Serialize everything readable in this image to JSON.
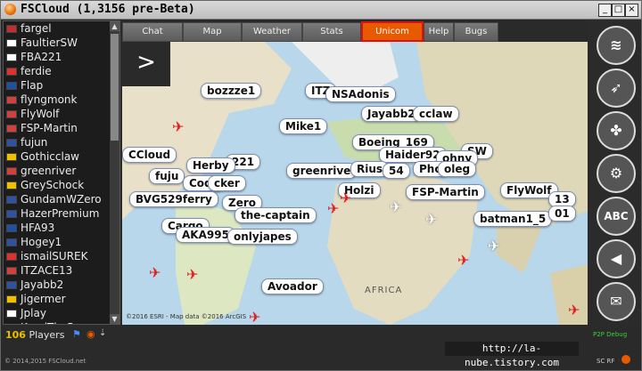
{
  "window": {
    "title": "FSCloud (1,3156 pre-Beta)",
    "buttons": [
      "_",
      "□",
      "×"
    ]
  },
  "sidebar": {
    "users": [
      {
        "name": "fargel",
        "flag": "#c03030"
      },
      {
        "name": "FaultierSW",
        "flag": "#ffffff"
      },
      {
        "name": "FBA221",
        "flag": "#ffffff"
      },
      {
        "name": "ferdie",
        "flag": "#e03030"
      },
      {
        "name": "Flap",
        "flag": "#2050a0"
      },
      {
        "name": "flyngmonk",
        "flag": "#d04040"
      },
      {
        "name": "FlyWolf",
        "flag": "#d04040"
      },
      {
        "name": "FSP-Martin",
        "flag": "#d04040"
      },
      {
        "name": "fujun",
        "flag": "#3050a0"
      },
      {
        "name": "Gothicclaw",
        "flag": "#f0c000"
      },
      {
        "name": "greenriver",
        "flag": "#d04040"
      },
      {
        "name": "GreySchock",
        "flag": "#f0c000"
      },
      {
        "name": "GundamWZero",
        "flag": "#3050a0"
      },
      {
        "name": "HazerPremium",
        "flag": "#3050a0"
      },
      {
        "name": "HFA93",
        "flag": "#2050a0"
      },
      {
        "name": "Hogey1",
        "flag": "#3050a0"
      },
      {
        "name": "ismailSUREK",
        "flag": "#e03030"
      },
      {
        "name": "ITZACE13",
        "flag": "#d04040"
      },
      {
        "name": "Jayabb2",
        "flag": "#3050a0"
      },
      {
        "name": "Jigermer",
        "flag": "#f0c000"
      },
      {
        "name": "Jplay",
        "flag": "#ffffff"
      },
      {
        "name": "KamiThePony",
        "flag": "#202020"
      }
    ],
    "players_count": "106",
    "players_label": "Players"
  },
  "tabs": [
    {
      "label": "Chat",
      "active": false
    },
    {
      "label": "Map",
      "active": false
    },
    {
      "label": "Weather",
      "active": false
    },
    {
      "label": "Stats",
      "active": false
    },
    {
      "label": "Unicom",
      "active": true
    },
    {
      "label": "Help",
      "active": false
    },
    {
      "label": "Bugs",
      "active": false
    }
  ],
  "map": {
    "toggle_symbol": ">",
    "region_label": "AFRICA",
    "attribution": "©2016 ESRI - Map data ©2016 ArcGIS",
    "callsigns": [
      {
        "name": "bozzze1"
      },
      {
        "name": "ITZ"
      },
      {
        "name": "NSAdonis"
      },
      {
        "name": "Jayabb2"
      },
      {
        "name": "cclaw"
      },
      {
        "name": "Mike1"
      },
      {
        "name": "Boeing_169"
      },
      {
        "name": "SW"
      },
      {
        "name": "Haider92"
      },
      {
        "name": "ohny"
      },
      {
        "name": "CCloud"
      },
      {
        "name": "221"
      },
      {
        "name": "Herby"
      },
      {
        "name": "greenrive"
      },
      {
        "name": "Rius"
      },
      {
        "name": "Pho"
      },
      {
        "name": "oleg"
      },
      {
        "name": "fuju"
      },
      {
        "name": "Cody"
      },
      {
        "name": "cker"
      },
      {
        "name": "Holzi"
      },
      {
        "name": "FSP-Martin"
      },
      {
        "name": "FlyWolf"
      },
      {
        "name": "BVG529ferry"
      },
      {
        "name": "Zero"
      },
      {
        "name": "the-captain"
      },
      {
        "name": "batman1_5"
      },
      {
        "name": "Cargo"
      },
      {
        "name": "AKA995"
      },
      {
        "name": "onlyjapes"
      },
      {
        "name": "Avoador"
      },
      {
        "name": "54"
      },
      {
        "name": "13"
      },
      {
        "name": "01"
      }
    ]
  },
  "rightbar": {
    "buttons": [
      {
        "icon": "wifi-icon",
        "glyph": "≋"
      },
      {
        "icon": "compass-icon",
        "glyph": "➶"
      },
      {
        "icon": "puzzle-icon",
        "glyph": "✤"
      },
      {
        "icon": "gear-icon",
        "glyph": "⚙"
      },
      {
        "icon": "abc-icon",
        "glyph": "ABC"
      },
      {
        "icon": "speaker-icon",
        "glyph": "◀"
      },
      {
        "icon": "mail-icon",
        "glyph": "✉"
      }
    ],
    "p2p_label": "P2P Debug",
    "sc_rf_label": "SC RF"
  },
  "footer": {
    "copyright": "© 2014,2015 FSCloud.net",
    "watermark": "http://la-nube.tistory.com"
  }
}
